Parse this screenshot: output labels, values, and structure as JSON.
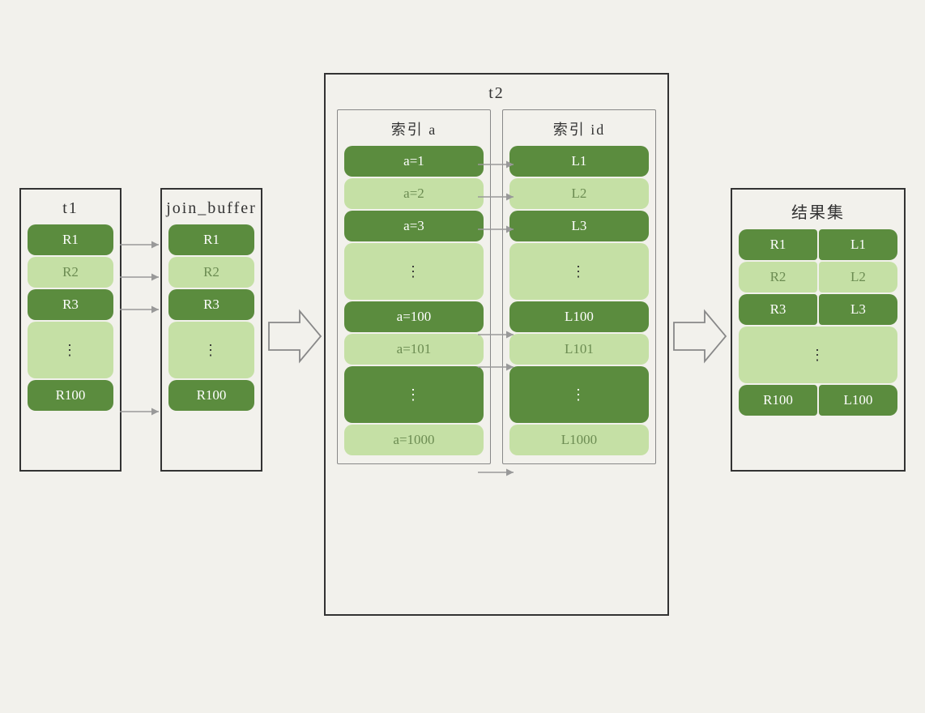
{
  "t1": {
    "title": "t1",
    "rows": [
      "R1",
      "R2",
      "R3",
      "⋮",
      "R100"
    ]
  },
  "join_buffer": {
    "title": "join_buffer",
    "rows": [
      "R1",
      "R2",
      "R3",
      "⋮",
      "R100"
    ]
  },
  "t2": {
    "title": "t2",
    "index_a": {
      "title": "索引 a",
      "rows": [
        "a=1",
        "a=2",
        "a=3",
        "⋮",
        "a=100",
        "a=101",
        "⋮",
        "a=1000"
      ]
    },
    "index_id": {
      "title": "索引 id",
      "rows": [
        "L1",
        "L2",
        "L3",
        "⋮",
        "L100",
        "L101",
        "⋮",
        "L1000"
      ]
    }
  },
  "result": {
    "title": "结果集",
    "pairs": [
      [
        "R1",
        "L1"
      ],
      [
        "R2",
        "L2"
      ],
      [
        "R3",
        "L3"
      ],
      [
        "⋮",
        "⋮"
      ],
      [
        "R100",
        "L100"
      ]
    ]
  },
  "colors": {
    "dark": "#5b8c3e",
    "light": "#c5e0a5"
  }
}
